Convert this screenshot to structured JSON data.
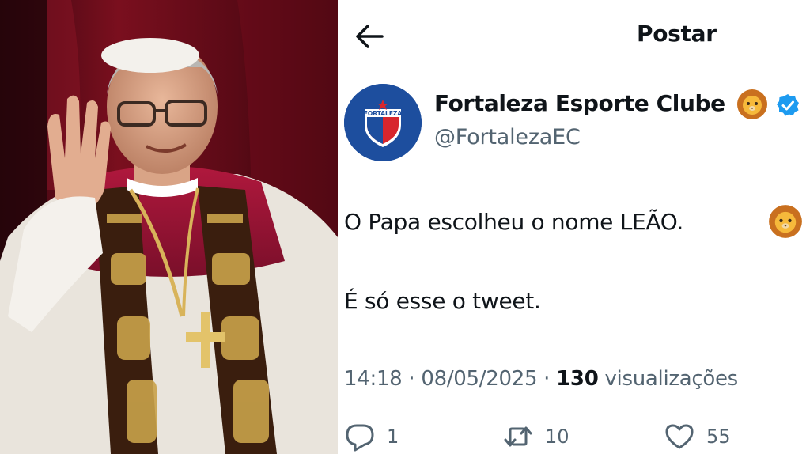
{
  "header": {
    "title": "Postar"
  },
  "account": {
    "display_name": "Fortaleza Esporte Clube",
    "handle": "@FortalezaEC",
    "avatar_text": "FORTALEZA",
    "badge_emoji": "lion-emoji-icon",
    "verified": true,
    "verified_color": "#1d9bf0"
  },
  "tweet": {
    "line1": "O Papa escolheu o nome LEÃO.",
    "line2": "É só esse o tweet."
  },
  "meta": {
    "time": "14:18",
    "separator": "·",
    "date": "08/05/2025",
    "views_count": "130",
    "views_label": "visualizações"
  },
  "actions": {
    "replies": "1",
    "retweets": "10",
    "likes": "55"
  },
  "colors": {
    "text": "#0f1419",
    "secondary": "#536471",
    "avatar_bg": "#1d4e9e",
    "accent": "#1d9bf0"
  }
}
